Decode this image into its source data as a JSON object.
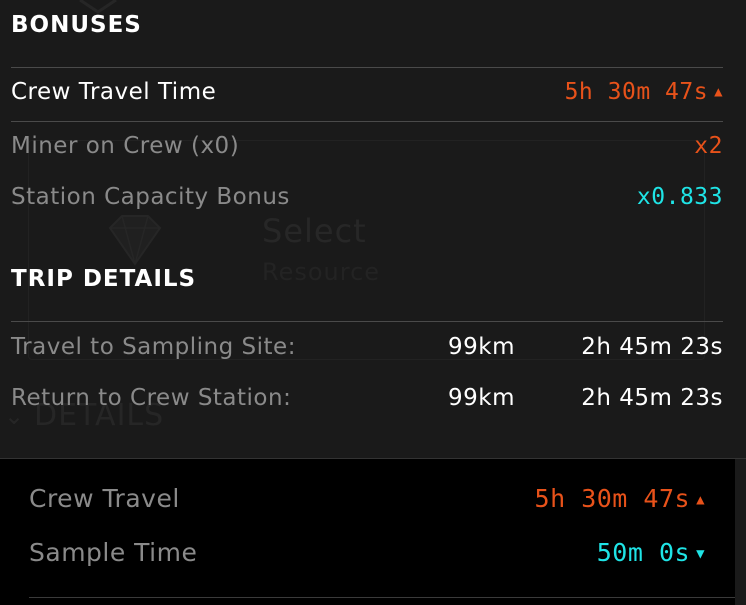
{
  "background": {
    "select_label": "Select",
    "resource_label": "Resource",
    "details_label": "DETAILS"
  },
  "bonuses": {
    "title": "BONUSES",
    "crew_travel_time": {
      "label": "Crew Travel Time",
      "value": "5h 30m 47s",
      "trend": "up",
      "color": "#e8521a"
    },
    "miner_on_crew": {
      "label": "Miner on Crew (x0)",
      "value": "x2",
      "color": "#e8521a"
    },
    "station_capacity_bonus": {
      "label": "Station Capacity Bonus",
      "value": "x0.833",
      "color": "#1fe4e6"
    }
  },
  "trip_details": {
    "title": "TRIP DETAILS",
    "rows": [
      {
        "label": "Travel to Sampling Site:",
        "distance": "99km",
        "duration": "2h 45m 23s"
      },
      {
        "label": "Return to Crew Station:",
        "distance": "99km",
        "duration": "2h 45m 23s"
      }
    ]
  },
  "summary": {
    "crew_travel": {
      "label": "Crew Travel",
      "value": "5h 30m 47s",
      "trend": "up",
      "color": "#e8521a"
    },
    "sample_time": {
      "label": "Sample Time",
      "value": "50m 0s",
      "trend": "down",
      "color": "#1fe4e6"
    }
  },
  "icons": {
    "trend_up": "▲",
    "trend_down": "▼",
    "chevron": "⌄"
  }
}
